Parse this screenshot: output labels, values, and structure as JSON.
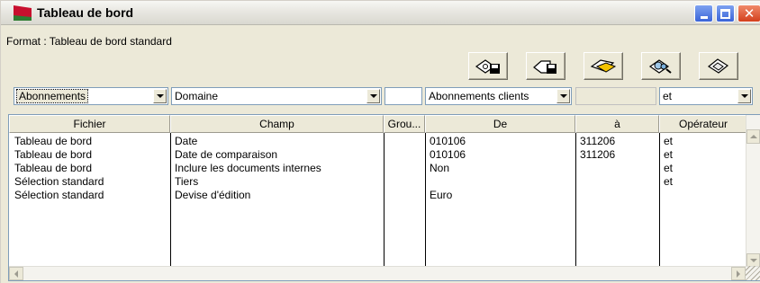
{
  "window": {
    "title": "Tableau de bord",
    "colors": {
      "icon_red": "#c8102e",
      "icon_green": "#2e7d32",
      "close": "#d3401c",
      "minmax": "#3a64d8"
    }
  },
  "format": {
    "label": "Format : Tableau de bord standard"
  },
  "toolbar": {
    "buttons": [
      {
        "icon": "save-disk-icon"
      },
      {
        "icon": "save-as-disk-icon"
      },
      {
        "icon": "open-folder-icon"
      },
      {
        "icon": "print-preview-icon"
      },
      {
        "icon": "eraser-icon"
      }
    ]
  },
  "filters": {
    "file": "Abonnements",
    "field": "Domaine",
    "group": "",
    "from": "Abonnements clients",
    "to": "",
    "operator": "et"
  },
  "grid": {
    "headers": [
      "Fichier",
      "Champ",
      "Grou...",
      "De",
      "à",
      "Opérateur"
    ],
    "rows": [
      [
        "Tableau de bord",
        "Date",
        "",
        "010106",
        "311206",
        "et"
      ],
      [
        "Tableau de bord",
        "Date de comparaison",
        "",
        "010106",
        "311206",
        "et"
      ],
      [
        "Tableau de bord",
        "Inclure les documents internes",
        "",
        "Non",
        "",
        "et"
      ],
      [
        "Sélection standard",
        "Tiers",
        "",
        "",
        "",
        "et"
      ],
      [
        "Sélection standard",
        "Devise d'édition",
        "",
        "Euro",
        "",
        ""
      ]
    ]
  }
}
